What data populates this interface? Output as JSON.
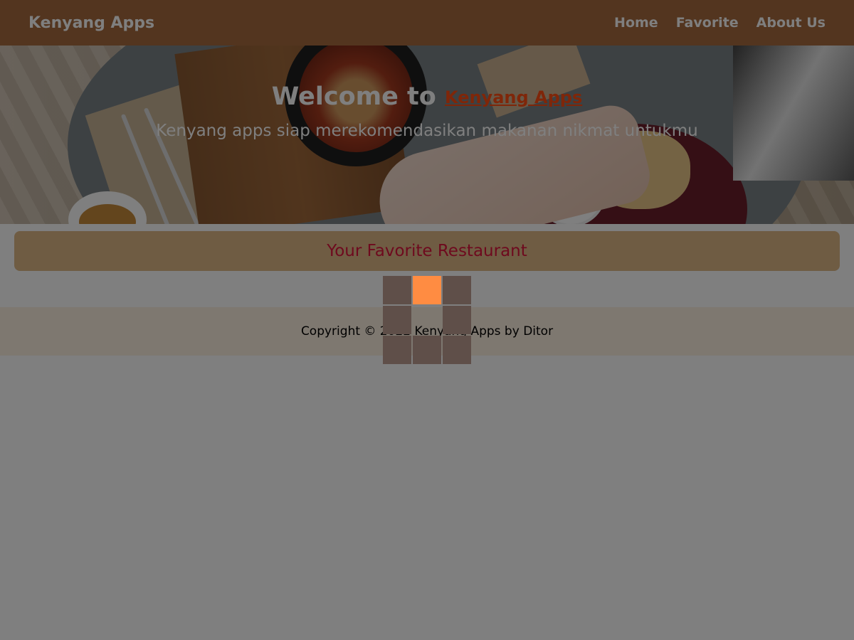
{
  "header": {
    "brand": "Kenyang Apps",
    "nav": [
      {
        "label": "Home"
      },
      {
        "label": "Favorite"
      },
      {
        "label": "About Us"
      }
    ],
    "color": "#a66a3e"
  },
  "hero": {
    "title_prefix": "Welcome to",
    "title_link": "Kenyang Apps",
    "subtitle": "Kenyang apps siap merekomendasikan makanan nikmat untukmu",
    "link_color": "#ff4d12"
  },
  "main": {
    "section_heading": "Your Favorite Restaurant",
    "heading_bg": "#deb887",
    "heading_color": "#dc143c"
  },
  "footer": {
    "text": "Copyright © 2022 Kenyang Apps by Ditor",
    "bg": "#fdf0e0"
  },
  "loader": {
    "active_color": "#ff8c42",
    "cell_color": "#5f4f49",
    "cells": [
      "filled",
      "active",
      "filled",
      "filled",
      "empty",
      "filled",
      "filled",
      "filled",
      "filled"
    ]
  },
  "overlay": {
    "opacity": 0.5
  }
}
